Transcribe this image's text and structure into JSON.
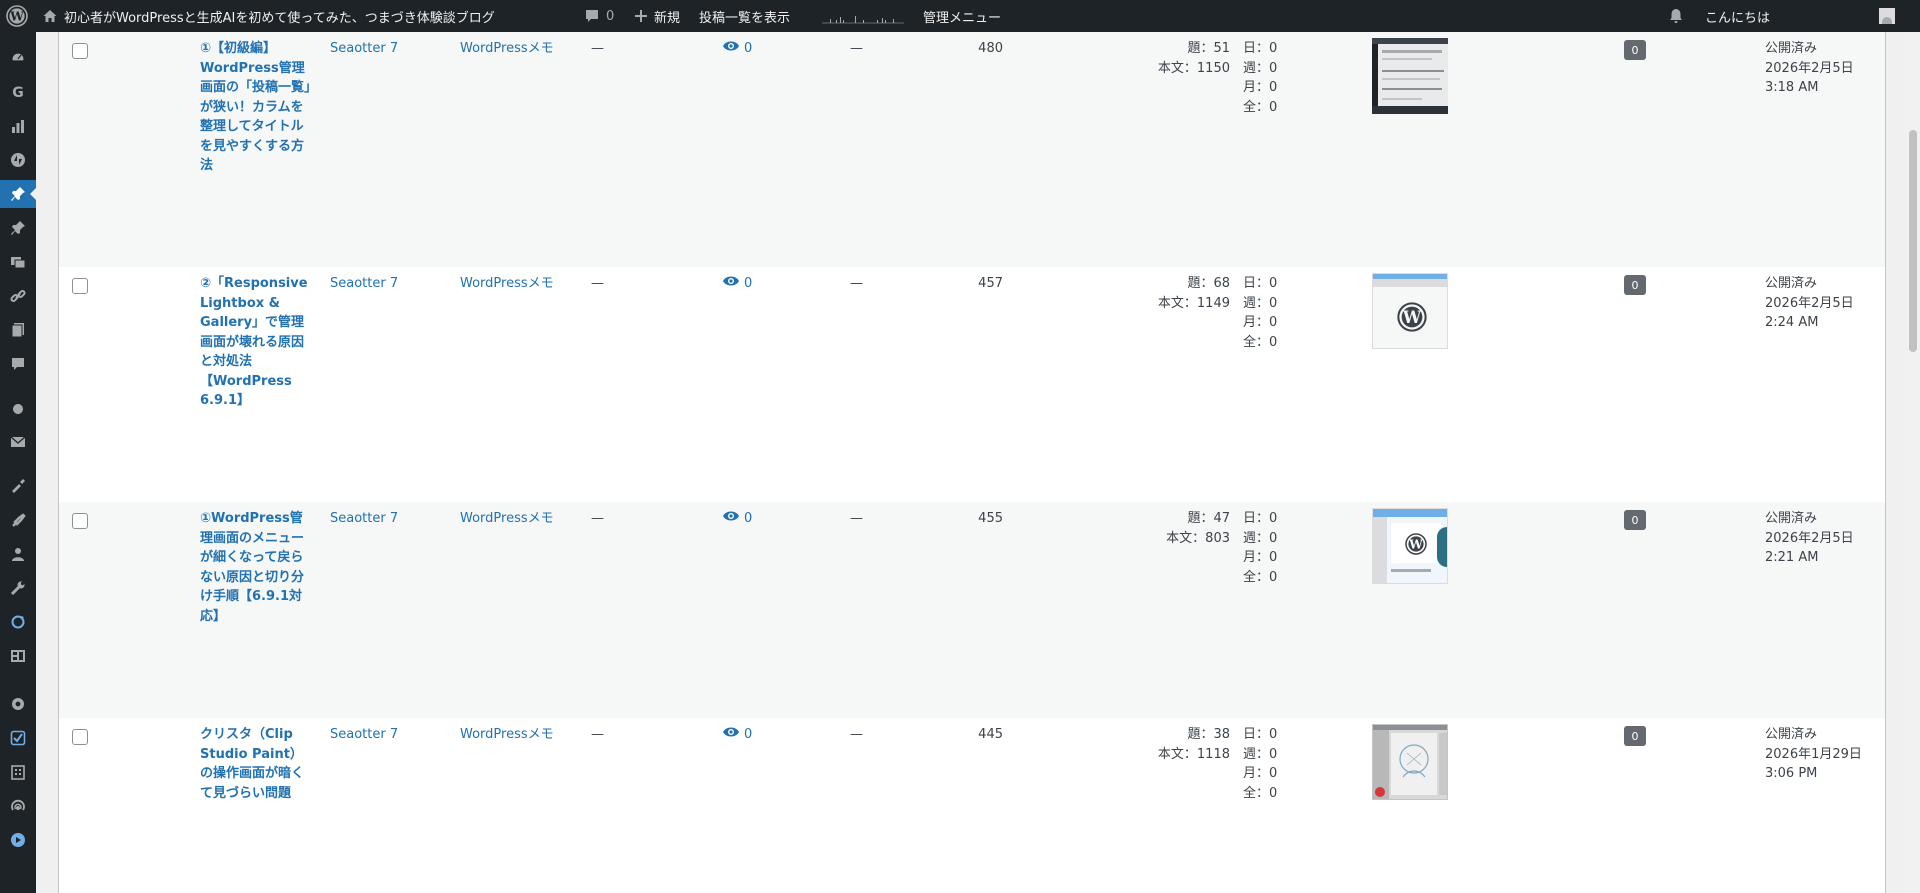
{
  "adminbar": {
    "site_name": "初心者がWordPressと生成AIを初めて使ってみた、つまづき体験談ブログ",
    "comments_count": "0",
    "new_label": "新規",
    "view_posts_label": "投稿一覧を表示",
    "admin_menu_label": "管理メニュー",
    "greeting": "こんにちは"
  },
  "sidemenu": {
    "icons": [
      "dashboard-icon",
      "google-icon",
      "stats-icon",
      "jetpack-icon",
      "posts-icon",
      "pin-icon",
      "media-icon",
      "links-icon",
      "pages-icon",
      "comments-icon",
      "drop-icon",
      "mail-icon",
      "appearance-icon",
      "plugins-icon",
      "users-icon",
      "tools-icon",
      "sync-icon",
      "widgets-icon",
      "settings-icon",
      "check-icon",
      "building-icon",
      "broadcast-icon",
      "play-icon"
    ],
    "current_item": "posts-icon"
  },
  "posts": [
    {
      "title": "①【初級編】WordPress管理画面の「投稿一覧」が狭い！カラムを整理してタイトルを見やすくする方法",
      "author": "Seaotter 7",
      "category": "WordPressメモ",
      "tags": "—",
      "views": "0",
      "comments": "—",
      "post_id": "480",
      "chars_title": "題：51",
      "chars_body": "本文：1150",
      "day": "日：0",
      "week": "週：0",
      "month": "月：0",
      "total": "全：0",
      "thumb_type": "screenshot-dark",
      "badge": "0",
      "status": "公開済み",
      "date": "2026年2月5日 3:18 AM"
    },
    {
      "title": "②「Responsive Lightbox & Gallery」で管理画面が壊れる原因と対処法【WordPress 6.9.1】",
      "author": "Seaotter 7",
      "category": "WordPressメモ",
      "tags": "—",
      "views": "0",
      "comments": "—",
      "post_id": "457",
      "chars_title": "題：68",
      "chars_body": "本文：1149",
      "day": "日：0",
      "week": "週：0",
      "month": "月：0",
      "total": "全：0",
      "thumb_type": "wordpress-logo",
      "badge": "0",
      "status": "公開済み",
      "date": "2026年2月5日 2:24 AM"
    },
    {
      "title": "①WordPress管理画面のメニューが細くなって戻らない原因と切り分け手順【6.9.1対応】",
      "author": "Seaotter 7",
      "category": "WordPressメモ",
      "tags": "—",
      "views": "0",
      "comments": "—",
      "post_id": "455",
      "chars_title": "題：47",
      "chars_body": "本文：803",
      "day": "日：0",
      "week": "週：0",
      "month": "月：0",
      "total": "全：0",
      "thumb_type": "wordpress-admin",
      "badge": "0",
      "status": "公開済み",
      "date": "2026年2月5日 2:21 AM"
    },
    {
      "title": "クリスタ（Clip Studio Paint）の操作画面が暗くて見づらい問題",
      "author": "Seaotter 7",
      "category": "WordPressメモ",
      "tags": "—",
      "views": "0",
      "comments": "—",
      "post_id": "445",
      "chars_title": "題：38",
      "chars_body": "本文：1118",
      "day": "日：0",
      "week": "週：0",
      "month": "月：0",
      "total": "全：0",
      "thumb_type": "clip-studio",
      "badge": "0",
      "status": "公開済み",
      "date": "2026年1月29日 3:06 PM"
    }
  ],
  "colors": {
    "adminbar": "#1d2327",
    "link": "#2271b1",
    "current_menu": "#2271b1",
    "row_alt": "#f6f7f7",
    "badge": "#646970"
  }
}
